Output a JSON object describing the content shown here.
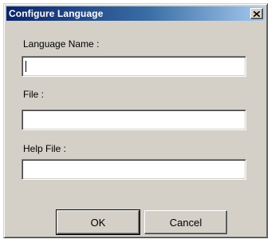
{
  "window": {
    "title": "Configure Language",
    "close_icon": "close-icon"
  },
  "form": {
    "language_name": {
      "label": "Language Name :",
      "value": ""
    },
    "file": {
      "label": "File :",
      "value": ""
    },
    "help_file": {
      "label": "Help File :",
      "value": ""
    }
  },
  "buttons": {
    "ok_label": "OK",
    "cancel_label": "Cancel"
  }
}
